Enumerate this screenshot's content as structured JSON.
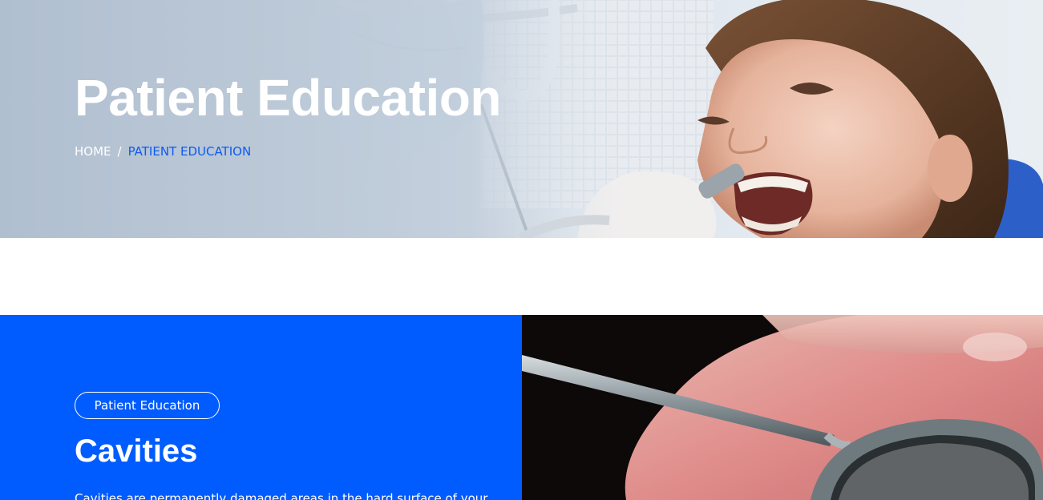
{
  "hero": {
    "title": "Patient Education",
    "breadcrumb": {
      "home": "HOME",
      "separator": "/",
      "current": "PATIENT EDUCATION"
    },
    "image": "dental-patient-examination-photo"
  },
  "feature": {
    "badge": "Patient Education",
    "heading": "Cavities",
    "text": "Cavities are permanently damaged areas in the hard surface of your",
    "image": "dental-instruments-photo"
  },
  "colors": {
    "accent_blue": "#005cfe",
    "breadcrumb_active": "#0d5bf2",
    "white": "#ffffff"
  }
}
